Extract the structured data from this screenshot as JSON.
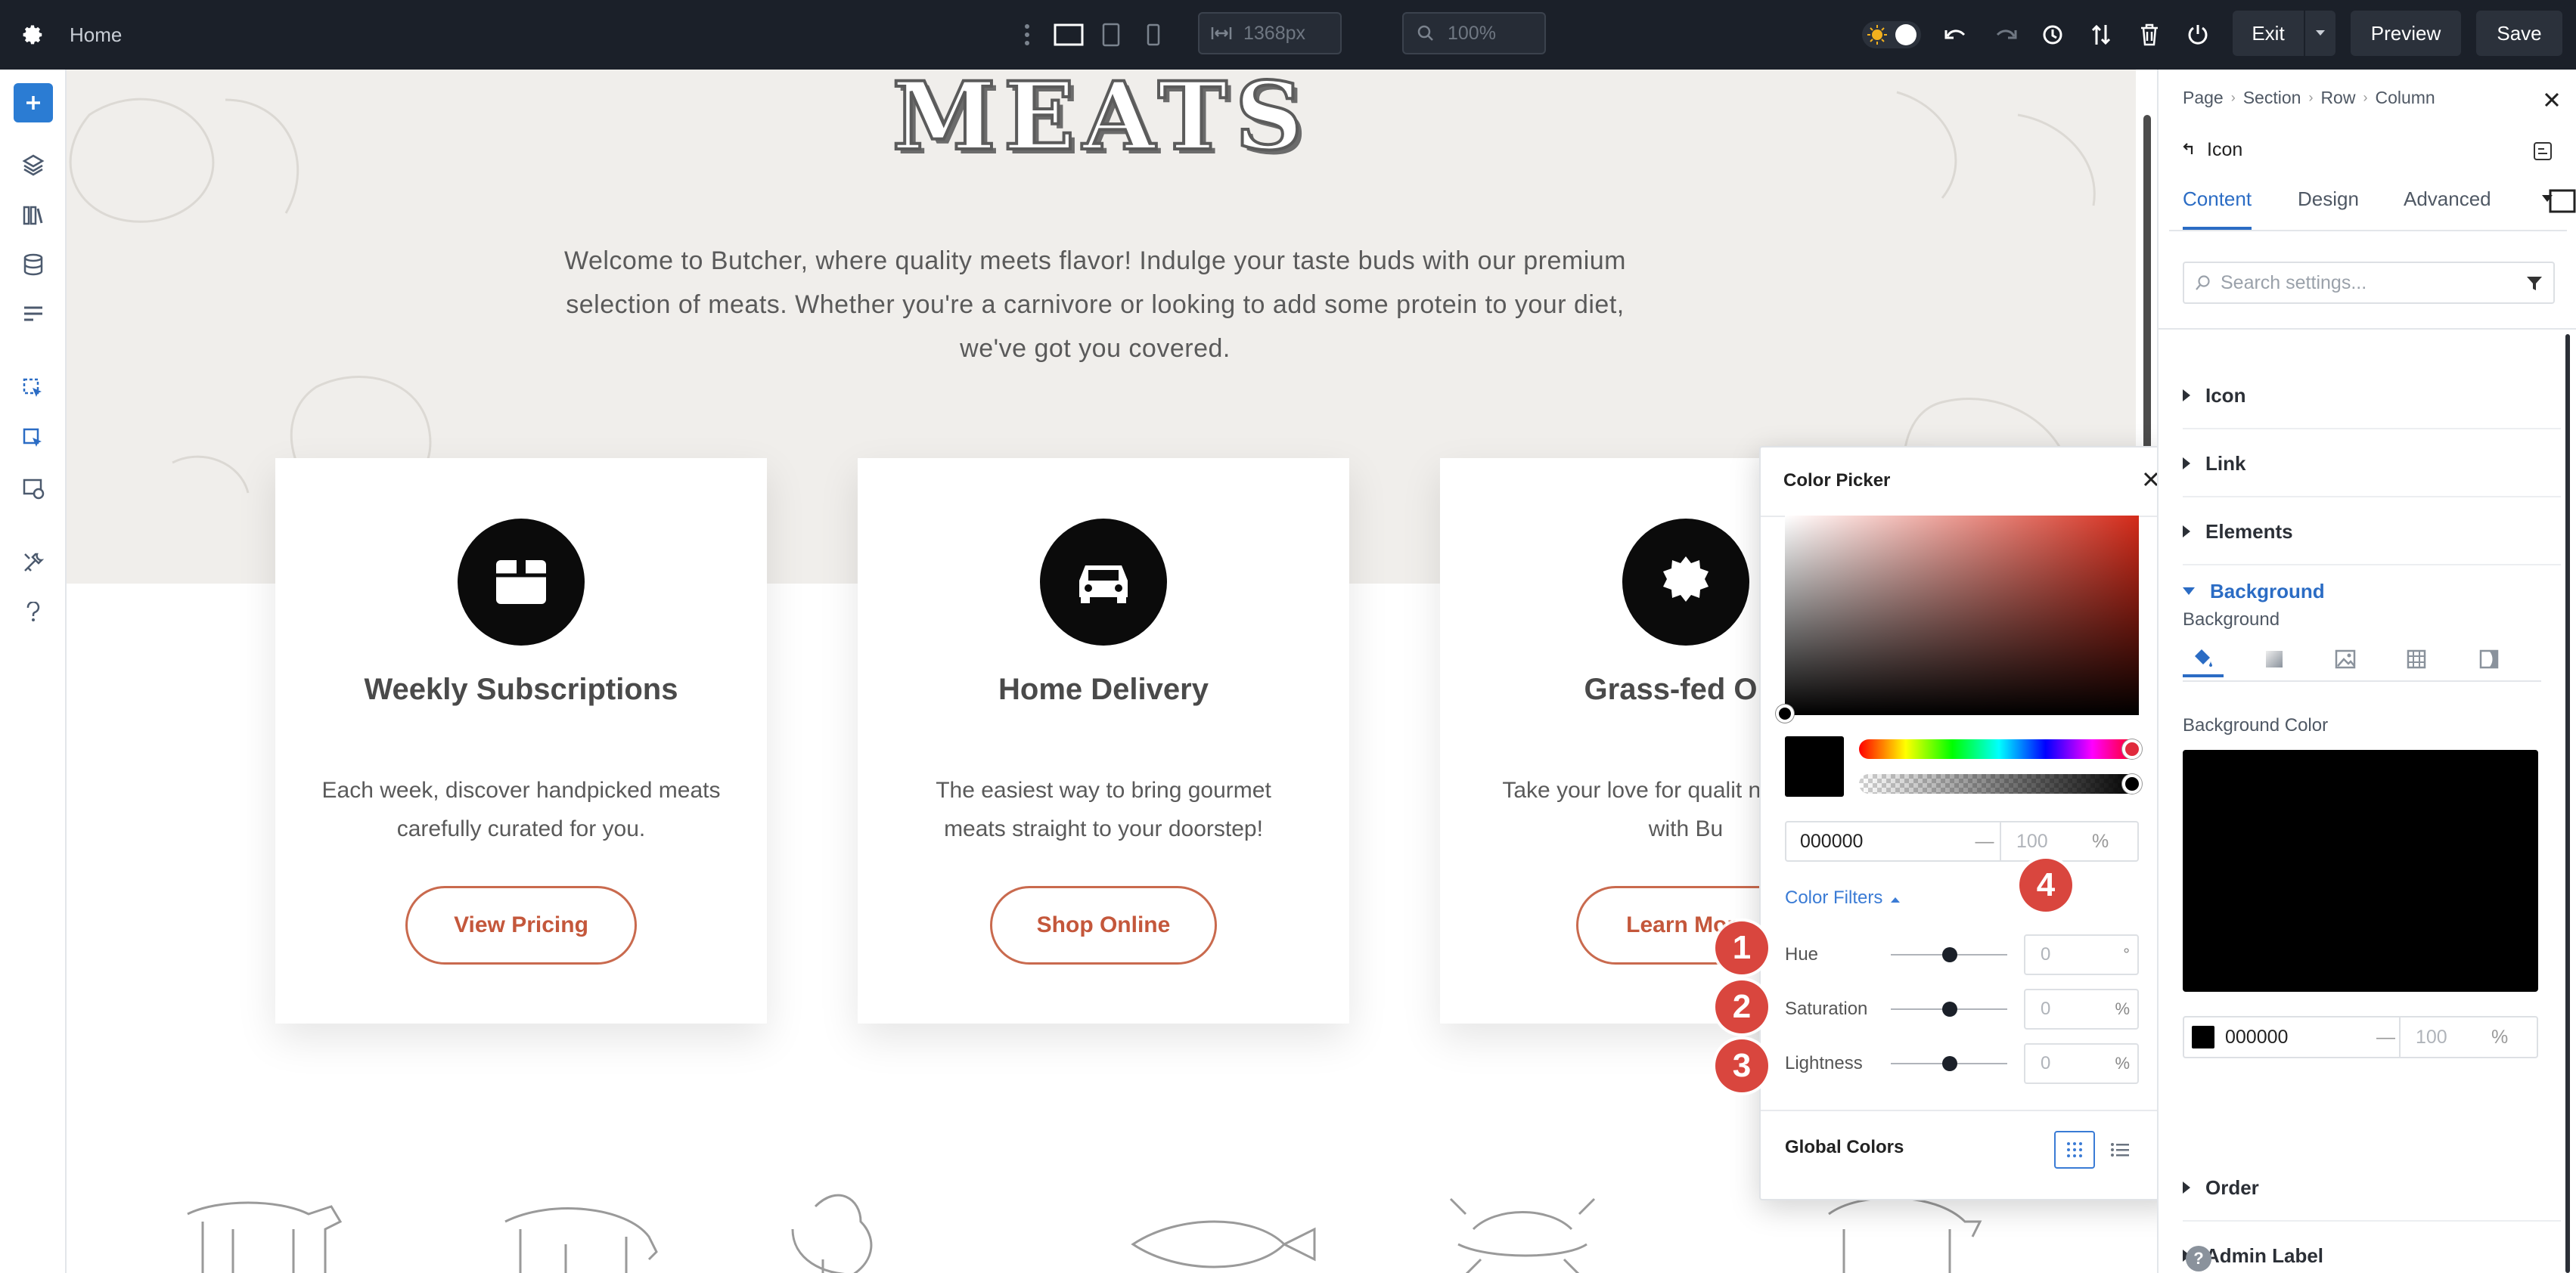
{
  "topbar": {
    "page_name": "Home",
    "width_value": "1368px",
    "zoom_value": "100%",
    "exit_label": "Exit",
    "preview_label": "Preview",
    "save_label": "Save"
  },
  "canvas": {
    "heading": "MEATS",
    "welcome": "Welcome to Butcher, where quality meets flavor! Indulge your taste buds with our premium selection of meats. Whether you're a carnivore or looking to add some protein to your diet, we've got you covered.",
    "cards": [
      {
        "title": "Weekly Subscriptions",
        "desc": "Each week, discover handpicked meats carefully curated for you.",
        "button": "View Pricing",
        "icon": "box-icon"
      },
      {
        "title": "Home Delivery",
        "desc": "The easiest way to bring gourmet meats straight to your doorstep!",
        "button": "Shop Online",
        "icon": "car-icon"
      },
      {
        "title": "Grass-fed Org",
        "desc": "Take your love for qualit new heights with Bu",
        "button": "Learn More",
        "icon": "badge-icon"
      }
    ]
  },
  "color_picker": {
    "title": "Color Picker",
    "hex": "000000",
    "hex_dash": "—",
    "alpha": "100",
    "alpha_unit": "%",
    "filters_label": "Color Filters",
    "filters": [
      {
        "label": "Hue",
        "value": "0",
        "unit": "°"
      },
      {
        "label": "Saturation",
        "value": "0",
        "unit": "%"
      },
      {
        "label": "Lightness",
        "value": "0",
        "unit": "%"
      }
    ],
    "global_colors": "Global Colors",
    "current_color": "#000000",
    "hue_color": "#d42b1a"
  },
  "badges": [
    "1",
    "2",
    "3",
    "4"
  ],
  "panel": {
    "breadcrumb": [
      "Page",
      "Section",
      "Row",
      "Column"
    ],
    "module": "Icon",
    "tabs": [
      "Content",
      "Design",
      "Advanced"
    ],
    "search_placeholder": "Search settings...",
    "groups": {
      "icon": "Icon",
      "link": "Link",
      "elements": "Elements",
      "background": "Background",
      "order": "Order",
      "admin": "Admin Label"
    },
    "background_label": "Background",
    "background_color_label": "Background Color",
    "bg_hex": "000000",
    "bg_dash": "—",
    "bg_alpha": "100",
    "bg_unit": "%",
    "help": "?"
  }
}
